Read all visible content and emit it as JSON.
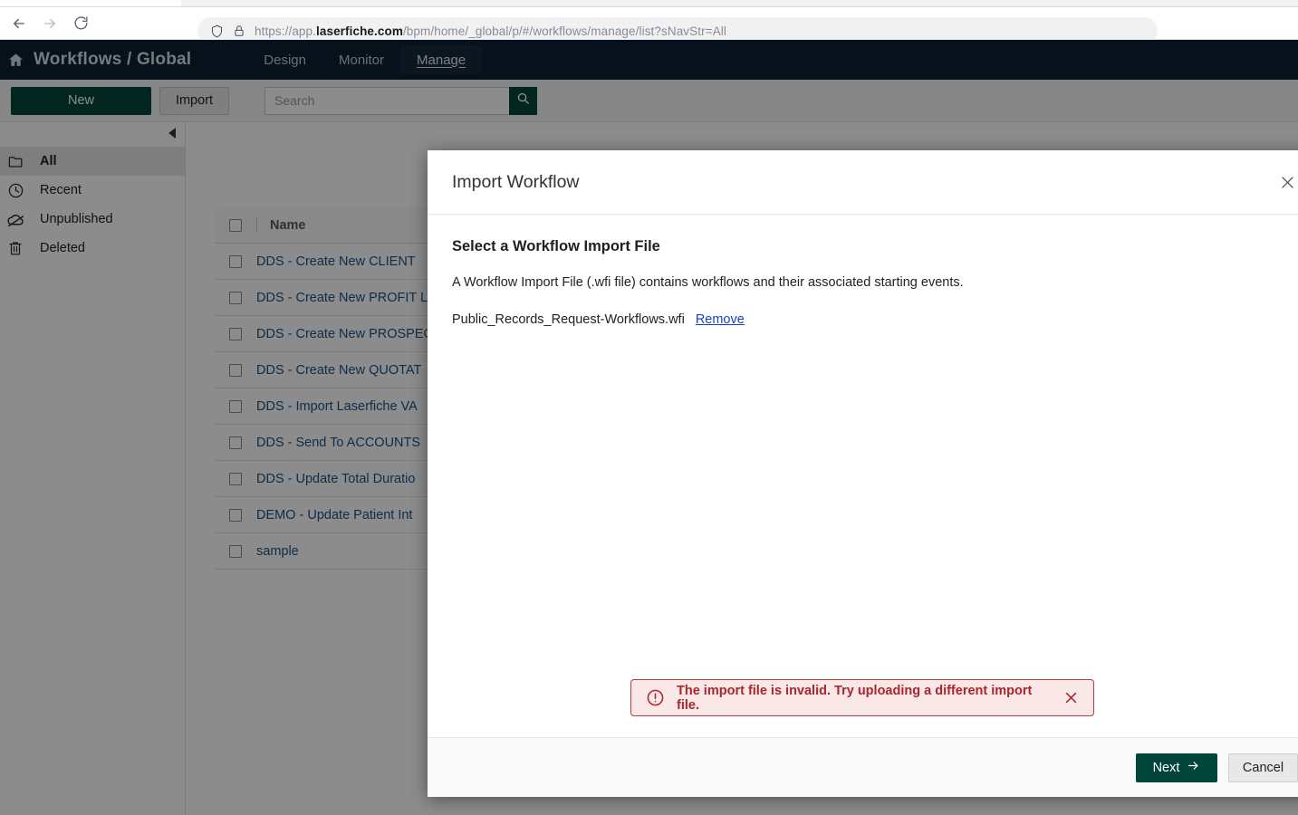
{
  "browser": {
    "back_label": "Back",
    "forward_label": "Forward",
    "reload_label": "Reload",
    "url_prefix": "https://app.",
    "url_domain": "laserfiche.com",
    "url_path": "/bpm/home/_global/p/#/workflows/manage/list?sNavStr=All",
    "shield_icon": "shield-icon",
    "lock_icon": "lock-icon"
  },
  "app_header": {
    "home_icon": "home-icon",
    "title": "Workflows / Global",
    "tabs": [
      {
        "label": "Design",
        "active": false
      },
      {
        "label": "Monitor",
        "active": false
      },
      {
        "label": "Manage",
        "active": true
      }
    ]
  },
  "toolbar": {
    "new_label": "New",
    "import_label": "Import",
    "search_placeholder": "Search",
    "search_value": "",
    "search_icon": "search-icon"
  },
  "sidebar": {
    "collapse_icon": "chevron-left-icon",
    "items": [
      {
        "label": "All",
        "icon": "folder-icon",
        "active": true
      },
      {
        "label": "Recent",
        "icon": "clock-icon",
        "active": false
      },
      {
        "label": "Unpublished",
        "icon": "cloud-off-icon",
        "active": false
      },
      {
        "label": "Deleted",
        "icon": "trash-icon",
        "active": false
      }
    ]
  },
  "list": {
    "columns": [
      "Name"
    ],
    "rows": [
      {
        "name": "DDS - Create New CLIENT"
      },
      {
        "name": "DDS - Create New PROFIT L"
      },
      {
        "name": "DDS - Create New PROSPEC"
      },
      {
        "name": "DDS - Create New QUOTAT"
      },
      {
        "name": "DDS - Import Laserfiche VA"
      },
      {
        "name": "DDS - Send To ACCOUNTS "
      },
      {
        "name": "DDS - Update Total Duratio"
      },
      {
        "name": "DEMO - Update Patient Int"
      },
      {
        "name": "sample"
      }
    ]
  },
  "modal": {
    "title": "Import Workflow",
    "close_icon": "close-icon",
    "section_title": "Select a Workflow Import File",
    "description": "A Workflow Import File (.wfi file) contains workflows and their associated starting events.",
    "file_name": "Public_Records_Request-Workflows.wfi",
    "remove_label": "Remove",
    "error": {
      "icon": "alert-circle-icon",
      "message": "The import file is invalid. Try uploading a different import file.",
      "dismiss_icon": "close-icon"
    },
    "next_label": "Next",
    "next_icon": "arrow-right-icon",
    "cancel_label": "Cancel"
  },
  "colors": {
    "brand_green": "#00453a",
    "header_navy": "#0b1f33",
    "link_blue": "#1a5288",
    "error_red": "#a8272d",
    "error_bg": "#fae7e7"
  }
}
